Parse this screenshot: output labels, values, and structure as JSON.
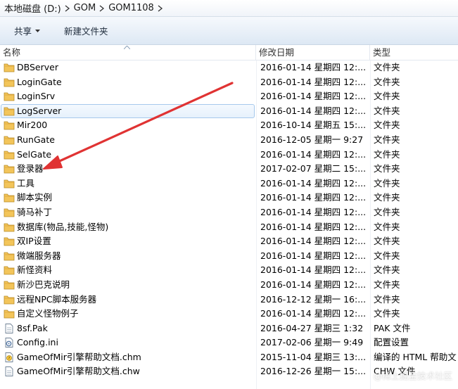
{
  "breadcrumb": [
    "本地磁盘 (D:)",
    "GOM",
    "GOM1108"
  ],
  "toolbar": {
    "share_label": "共享",
    "new_folder_label": "新建文件夹"
  },
  "columns": {
    "name": "名称",
    "date": "修改日期",
    "type": "类型"
  },
  "colors": {
    "folder": "#e9b64a",
    "arrow": "#e03333",
    "hover_border": "#a6c9ec"
  },
  "files": [
    {
      "name": "DBServer",
      "date": "2016-01-14 星期四 12:...",
      "type": "文件夹",
      "icon": "folder-icon"
    },
    {
      "name": "LoginGate",
      "date": "2016-01-14 星期四 12:...",
      "type": "文件夹",
      "icon": "folder-icon"
    },
    {
      "name": "LoginSrv",
      "date": "2016-01-14 星期四 12:...",
      "type": "文件夹",
      "icon": "folder-icon"
    },
    {
      "name": "LogServer",
      "date": "2016-01-14 星期四 12:...",
      "type": "文件夹",
      "icon": "folder-icon"
    },
    {
      "name": "Mir200",
      "date": "2016-10-14 星期五 15:...",
      "type": "文件夹",
      "icon": "folder-icon"
    },
    {
      "name": "RunGate",
      "date": "2016-12-05 星期一 9:27",
      "type": "文件夹",
      "icon": "folder-icon"
    },
    {
      "name": "SelGate",
      "date": "2016-01-14 星期四 12:...",
      "type": "文件夹",
      "icon": "folder-icon"
    },
    {
      "name": "登录器",
      "date": "2017-02-07 星期二 15:...",
      "type": "文件夹",
      "icon": "folder-icon"
    },
    {
      "name": "工具",
      "date": "2016-01-14 星期四 12:...",
      "type": "文件夹",
      "icon": "folder-icon"
    },
    {
      "name": "脚本实例",
      "date": "2016-01-14 星期四 12:...",
      "type": "文件夹",
      "icon": "folder-icon"
    },
    {
      "name": "骑马补丁",
      "date": "2016-01-14 星期四 12:...",
      "type": "文件夹",
      "icon": "folder-icon"
    },
    {
      "name": "数据库(物品,技能,怪物)",
      "date": "2016-01-14 星期四 12:...",
      "type": "文件夹",
      "icon": "folder-icon"
    },
    {
      "name": "双IP设置",
      "date": "2016-01-14 星期四 12:...",
      "type": "文件夹",
      "icon": "folder-icon"
    },
    {
      "name": "微端服务器",
      "date": "2016-01-14 星期四 12:...",
      "type": "文件夹",
      "icon": "folder-icon"
    },
    {
      "name": "新怪资料",
      "date": "2016-01-14 星期四 12:...",
      "type": "文件夹",
      "icon": "folder-icon"
    },
    {
      "name": "新沙巴克说明",
      "date": "2016-01-14 星期四 12:...",
      "type": "文件夹",
      "icon": "folder-icon"
    },
    {
      "name": "远程NPC脚本服务器",
      "date": "2016-12-12 星期一 16:...",
      "type": "文件夹",
      "icon": "folder-icon"
    },
    {
      "name": "自定义怪物例子",
      "date": "2016-01-14 星期四 12:...",
      "type": "文件夹",
      "icon": "folder-icon"
    },
    {
      "name": "8sf.Pak",
      "date": "2016-04-27 星期三 1:32",
      "type": "PAK 文件",
      "icon": "file-icon"
    },
    {
      "name": "Config.ini",
      "date": "2017-02-06 星期一 9:49",
      "type": "配置设置",
      "icon": "config-file-icon"
    },
    {
      "name": "GameOfMir引擎帮助文档.chm",
      "date": "2015-11-04 星期三 13:...",
      "type": "编译的 HTML 帮助文",
      "icon": "chm-file-icon"
    },
    {
      "name": "GameOfMir引擎帮助文档.chw",
      "date": "2016-12-26 星期一 15:...",
      "type": "CHW 文件",
      "icon": "file-icon"
    }
  ],
  "watermark": "@稀土掘金技术社区"
}
